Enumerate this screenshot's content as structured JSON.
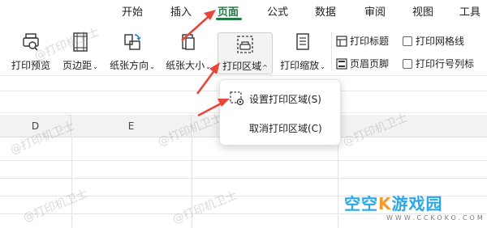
{
  "menu": {
    "tabs": [
      {
        "label": "开始"
      },
      {
        "label": "插入"
      },
      {
        "label": "页面"
      },
      {
        "label": "公式"
      },
      {
        "label": "数据"
      },
      {
        "label": "审阅"
      },
      {
        "label": "视图"
      },
      {
        "label": "工具"
      }
    ],
    "active_tab": "页面"
  },
  "ribbon": {
    "print_preview": "打印预览",
    "margins": "页边距",
    "orientation": "纸张方向",
    "paper_size": "纸张大小",
    "print_area": "打印区域",
    "print_scaling": "打印缩放",
    "print_titles": "打印标题",
    "header_footer": "页眉页脚",
    "print_gridlines": "打印网格线",
    "print_row_col_headers": "打印行号列标"
  },
  "sheet": {
    "columns": [
      "D",
      "E"
    ]
  },
  "dropdown": {
    "items": [
      {
        "label": "设置打印区域(S)",
        "icon": "set-print-area-icon"
      },
      {
        "label": "取消打印区域(C)"
      }
    ]
  },
  "watermark": "@打印机卫士",
  "logo": {
    "title": "空空",
    "title2": "游戏园",
    "url": "WWW.CCKOKO.COM"
  },
  "colors": {
    "accent": "#1f7a45",
    "arrow": "#e8473a",
    "logo": "#2aa7e9",
    "logo_k": "#f29b2b"
  }
}
